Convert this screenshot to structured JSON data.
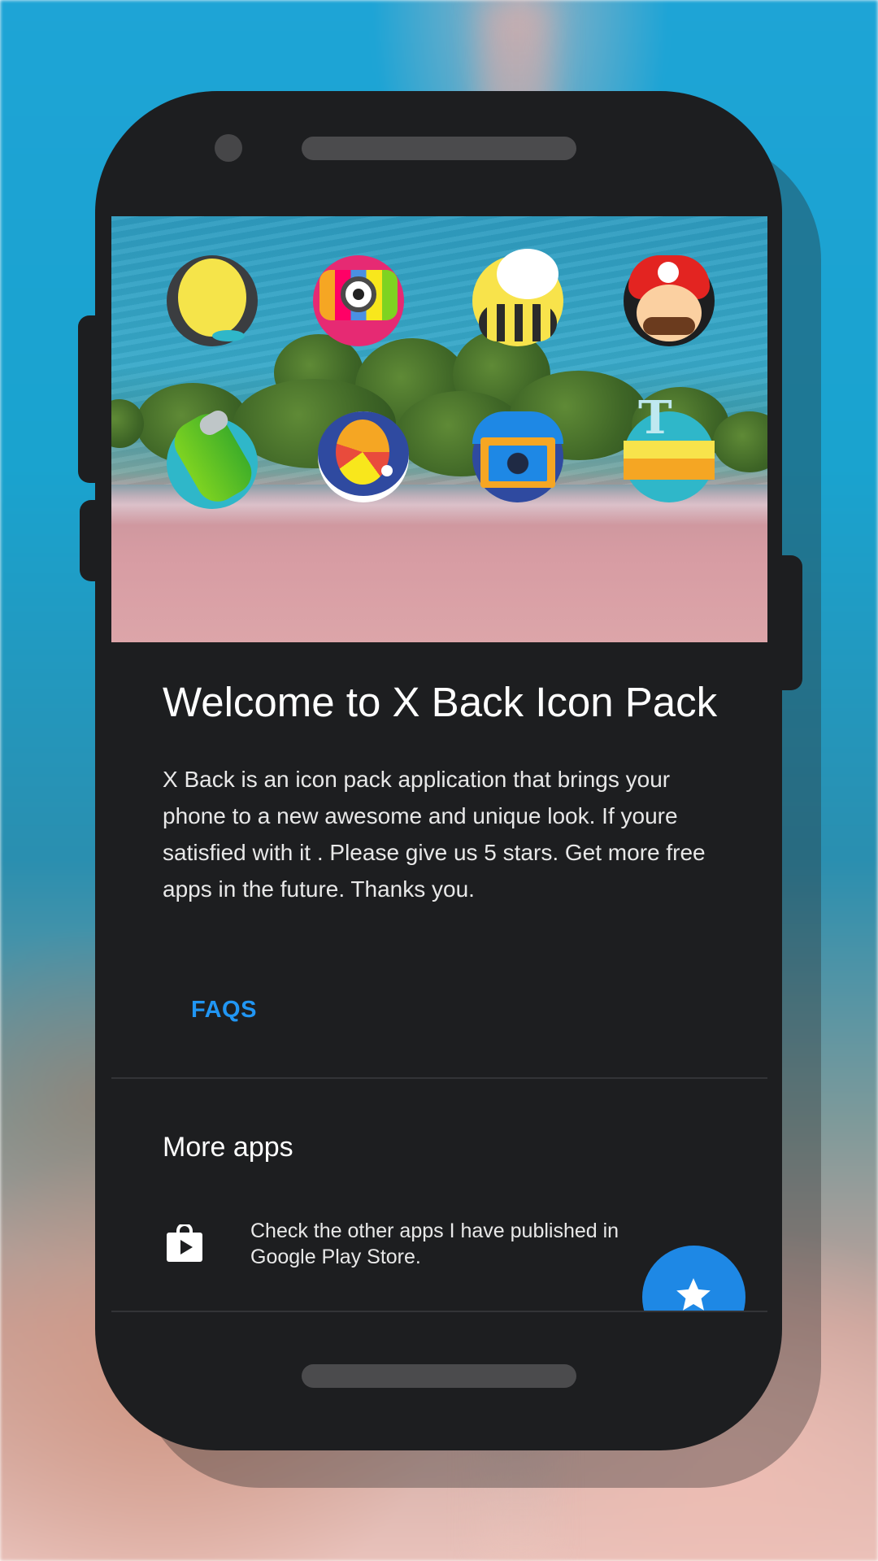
{
  "welcome": {
    "title": "Welcome to X Back Icon Pack",
    "description": "X Back is an icon pack application that brings your phone to a new awesome and unique look. If youre satisfied with it . Please give us 5 stars. Get more free apps in the future. Thanks you.",
    "faqs_label": "FAQS"
  },
  "more_apps": {
    "title": "More apps",
    "store_text": "Check the other apps I have published in Google Play Store."
  },
  "fab": {
    "icon": "star-icon"
  },
  "header": {
    "icons": [
      "dinosaur-app-icon",
      "camera-app-icon",
      "bee-chat-app-icon",
      "mario-app-icon",
      "battery-app-icon",
      "snake-game-app-icon",
      "box-app-icon",
      "text-app-icon"
    ]
  },
  "colors": {
    "accent": "#2196f3",
    "fab": "#1e88e5",
    "surface": "#1d1e20"
  }
}
